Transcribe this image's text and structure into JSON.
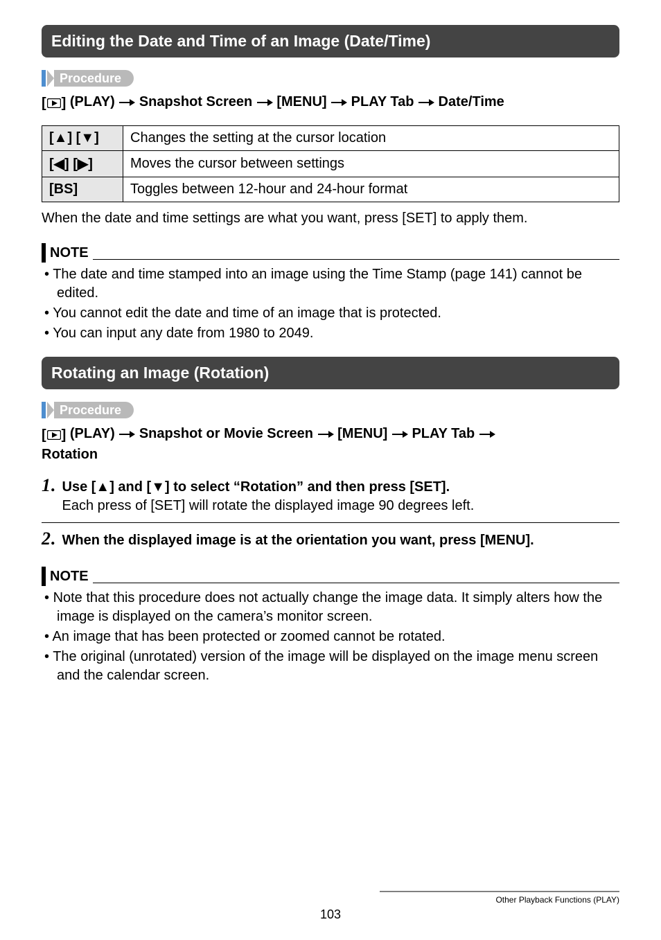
{
  "section1": {
    "title": "Editing the Date and Time of an Image (Date/Time)"
  },
  "procedure_label": "Procedure",
  "proc1": {
    "play_label": " (PLAY) ",
    "seg_snapshot": " Snapshot Screen ",
    "seg_menu": " [MENU] ",
    "seg_playtab": " PLAY Tab ",
    "seg_end": " Date/Time"
  },
  "table1": {
    "r1": {
      "key": "[▲] [▼]",
      "val": "Changes the setting at the cursor location"
    },
    "r2": {
      "key": "[◀] [▶]",
      "val": "Moves the cursor between settings"
    },
    "r3": {
      "key": "[BS]",
      "val": "Toggles between 12-hour and 24-hour format"
    }
  },
  "body_after_table": "When the date and time settings are what you want, press [SET] to apply them.",
  "note_label": "NOTE",
  "notes1": [
    "The date and time stamped into an image using the Time Stamp (page 141) cannot be edited.",
    "You cannot edit the date and time of an image that is protected.",
    "You can input any date from 1980 to 2049."
  ],
  "section2": {
    "title": "Rotating an Image (Rotation)"
  },
  "proc2": {
    "play_label": " (PLAY) ",
    "seg_snapshot": " Snapshot or Movie Screen ",
    "seg_menu": " [MENU] ",
    "seg_playtab": " PLAY Tab ",
    "seg_end": "Rotation"
  },
  "steps": {
    "s1_num": "1",
    "s1_dot": ".",
    "s1_lead_a": "Use [",
    "s1_lead_up": "▲",
    "s1_lead_b": "] and [",
    "s1_lead_dn": "▼",
    "s1_lead_c": "] to select “Rotation” and then press [SET].",
    "s1_body": "Each press of [SET] will rotate the displayed image 90 degrees left.",
    "s2_num": "2",
    "s2_dot": ".",
    "s2_lead": "When the displayed image is at the orientation you want, press [MENU]."
  },
  "notes2": [
    "Note that this procedure does not actually change the image data. It simply alters how the image is displayed on the camera’s monitor screen.",
    "An image that has been protected or zoomed cannot be rotated.",
    "The original (unrotated) version of the image will be displayed on the image menu screen and the calendar screen."
  ],
  "footer": {
    "page": "103",
    "right": "Other Playback Functions (PLAY)"
  }
}
